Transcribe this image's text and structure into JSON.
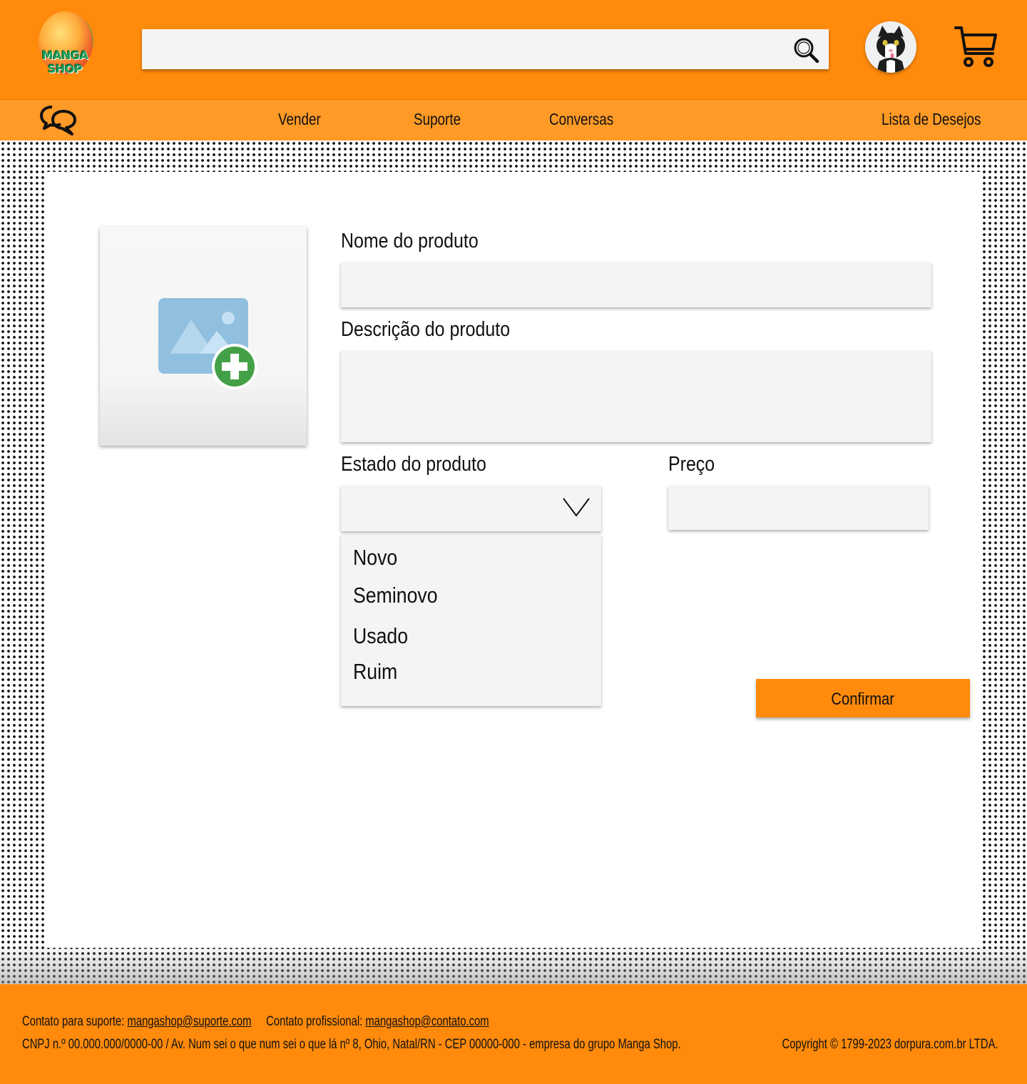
{
  "header": {
    "logo_text": "MANGA SHOP",
    "search": {
      "value": "",
      "placeholder": ""
    },
    "icons": {
      "search": "search-icon",
      "avatar": "cat-avatar",
      "cart": "cart-icon"
    }
  },
  "nav": {
    "chat_icon": "chat-bubbles-icon",
    "links": [
      {
        "label": "Vender"
      },
      {
        "label": "Suporte"
      },
      {
        "label": "Conversas"
      },
      {
        "label": "Lista de Desejos"
      }
    ]
  },
  "form": {
    "image_upload_icon": "add-image-icon",
    "name": {
      "label": "Nome do produto",
      "value": ""
    },
    "description": {
      "label": "Descrição do produto",
      "value": ""
    },
    "condition": {
      "label": "Estado do produto",
      "selected": "",
      "options": [
        "Novo",
        "Seminovo",
        "Usado",
        "Ruim"
      ]
    },
    "price": {
      "label": "Preço",
      "value": ""
    },
    "confirm_label": "Confirmar"
  },
  "footer": {
    "support_label": "Contato para suporte:",
    "support_email": "mangashop@suporte.com",
    "professional_label": "Contato profissional:",
    "professional_email": "mangashop@contato.com",
    "legal": "CNPJ n.º 00.000.000/0000-00 / Av. Num sei o que num sei o que lá nº 8, Ohio, Natal/RN - CEP 00000-000 - empresa do grupo Manga Shop.",
    "copyright": "Copyright © 1799-2023 dorpura.com.br LTDA."
  },
  "colors": {
    "brand_orange": "#ff8a0b",
    "nav_orange": "#ff9a26",
    "field_bg": "#f4f4f4",
    "add_icon_green": "#43a047",
    "image_icon_blue": "#90bfdf"
  }
}
